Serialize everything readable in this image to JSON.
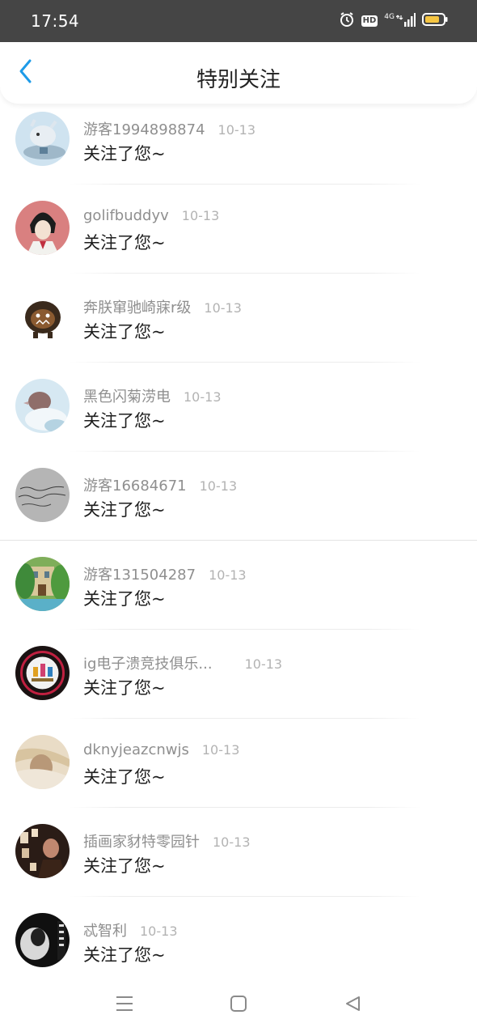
{
  "status_bar": {
    "time": "17:54",
    "hd_label": "HD",
    "network_label": "4G",
    "icons": [
      "alarm-icon",
      "hd-icon",
      "signal-icon",
      "battery-icon"
    ],
    "battery_color": "#f5c542"
  },
  "header": {
    "title": "特别关注",
    "back_icon": "chevron-left-icon",
    "accent_color": "#1e9be8"
  },
  "items": [
    {
      "username": "游客1994898874",
      "date": "10-13",
      "message": "关注了您~"
    },
    {
      "username": "golifbuddyv",
      "date": "10-13",
      "message": "关注了您~"
    },
    {
      "username": "奔朕窜驰崎寐r级",
      "date": "10-13",
      "message": "关注了您~"
    },
    {
      "username": "黑色闪菊涝电",
      "date": "10-13",
      "message": "关注了您~"
    },
    {
      "username": "游客16684671",
      "date": "10-13",
      "message": "关注了您~"
    },
    {
      "username": "游客131504287",
      "date": "10-13",
      "message": "关注了您~"
    },
    {
      "username": "ig电子溃竞技俱乐...",
      "date": "10-13",
      "message": "关注了您~"
    },
    {
      "username": "dknyjeazcnwjs",
      "date": "10-13",
      "message": "关注了您~"
    },
    {
      "username": "插画家豺特零园针",
      "date": "10-13",
      "message": "关注了您~"
    },
    {
      "username": "忒智利",
      "date": "10-13",
      "message": "关注了您~"
    }
  ],
  "nav_bar": {
    "icons": [
      "menu-icon",
      "home-square-icon",
      "back-triangle-icon"
    ]
  }
}
